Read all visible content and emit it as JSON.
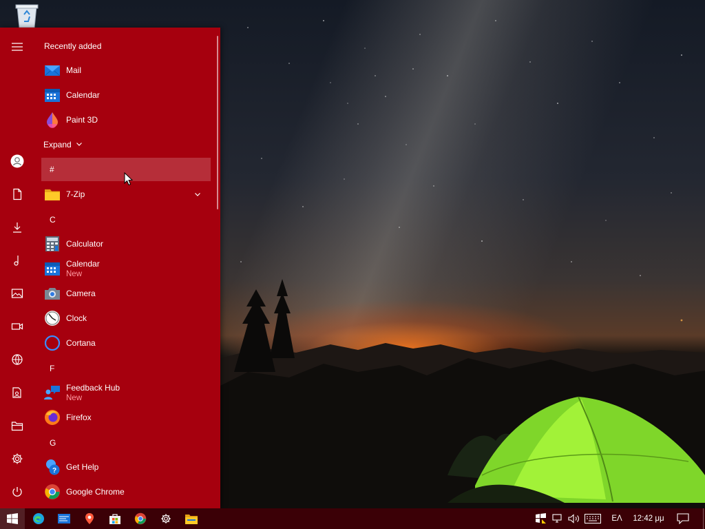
{
  "desktop": {
    "recycle_bin_icon": "recycle-bin-icon"
  },
  "start_menu": {
    "accent_color": "#a6000e",
    "recently_added_title": "Recently added",
    "recently_added": [
      {
        "label": "Mail",
        "icon": "mail-icon"
      },
      {
        "label": "Calendar",
        "icon": "calendar-icon"
      },
      {
        "label": "Paint 3D",
        "icon": "paint3d-icon"
      }
    ],
    "expand_label": "Expand",
    "groups": [
      {
        "letter": "#",
        "apps": [
          {
            "label": "7-Zip",
            "icon": "folder-icon",
            "has_dropdown": true
          }
        ]
      },
      {
        "letter": "C",
        "apps": [
          {
            "label": "Calculator",
            "icon": "calculator-icon"
          },
          {
            "label": "Calendar",
            "sub": "New",
            "icon": "calendar-icon"
          },
          {
            "label": "Camera",
            "icon": "camera-icon"
          },
          {
            "label": "Clock",
            "icon": "clock-icon"
          },
          {
            "label": "Cortana",
            "icon": "cortana-icon"
          }
        ]
      },
      {
        "letter": "F",
        "apps": [
          {
            "label": "Feedback Hub",
            "sub": "New",
            "icon": "feedback-hub-icon"
          },
          {
            "label": "Firefox",
            "icon": "firefox-icon"
          }
        ]
      },
      {
        "letter": "G",
        "apps": [
          {
            "label": "Get Help",
            "icon": "get-help-icon"
          },
          {
            "label": "Google Chrome",
            "icon": "chrome-icon"
          }
        ]
      }
    ],
    "rail_icons": [
      "hamburger-menu-icon",
      "user-account-icon",
      "documents-icon",
      "downloads-icon",
      "music-icon",
      "pictures-icon",
      "videos-icon",
      "network-icon",
      "personal-folder-icon",
      "file-explorer-icon",
      "settings-icon",
      "power-icon"
    ]
  },
  "taskbar": {
    "background": "#3b0006",
    "pinned": [
      "windows-start-icon",
      "edge-icon",
      "mail-store-icon",
      "maps-icon",
      "microsoft-store-icon",
      "chrome-icon",
      "settings-icon",
      "file-explorer-icon"
    ],
    "language": "ΕΛ",
    "time": "12:42 μμ"
  }
}
